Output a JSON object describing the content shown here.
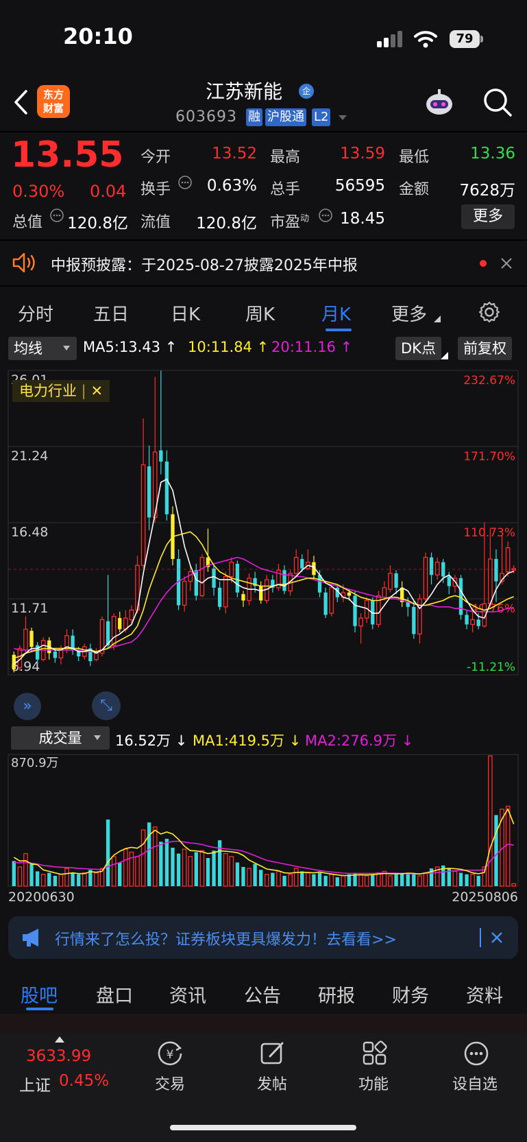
{
  "status_bar": {
    "time": "20:10",
    "battery": "79"
  },
  "nav": {
    "logo_line1": "东方",
    "logo_line2": "财富",
    "stock_name": "江苏新能",
    "qi_badge": "企",
    "stock_code": "603693",
    "tags": [
      "融",
      "沪股通",
      "L2"
    ]
  },
  "quote": {
    "price": "13.55",
    "change_pct": "0.30%",
    "change_abs": "0.04",
    "open_label": "今开",
    "open_value": "13.52",
    "high_label": "最高",
    "high_value": "13.59",
    "low_label": "最低",
    "low_value": "13.36",
    "turnover_label": "换手",
    "turnover_value": "0.63%",
    "volume_label": "总手",
    "volume_value": "56595",
    "amount_label": "金额",
    "amount_value": "7628万",
    "mcap_label": "总值",
    "mcap_value": "120.8亿",
    "float_label": "流值",
    "float_value": "120.8亿",
    "pe_label": "市盈",
    "pe_sup": "动",
    "pe_value": "18.45",
    "more_label": "更多"
  },
  "notice": {
    "text": "中报预披露：于2025-08-27披露2025年中报"
  },
  "period_tabs": [
    "分时",
    "五日",
    "日K",
    "周K",
    "月K",
    "更多"
  ],
  "active_period": "月K",
  "chart_controls": {
    "indicator_select": "均线",
    "ma5": "MA5:13.43",
    "ma10": "10:11.84",
    "ma20": "20:11.16",
    "dk_button": "DK点",
    "adjust_button": "前复权",
    "industry_tag": "电力行业",
    "volume_select": "成交量",
    "vol_value": "16.52万",
    "vol_ma1": "MA1:419.5万",
    "vol_ma2": "MA2:276.9万"
  },
  "colors": {
    "up": "#ff2d2d",
    "down": "#2ee04a",
    "accent": "#2e7cf6",
    "ma5": "#ffffff",
    "ma10": "#ffee2e",
    "ma20": "#e020d8",
    "candle_up": "#ff2d2d",
    "candle_down": "#3ad8dc"
  },
  "chart_data": {
    "type": "candlestick",
    "price_axis": [
      "26.01",
      "21.24",
      "16.48",
      "11.71",
      "6.94"
    ],
    "pct_axis": [
      "232.67%",
      "171.70%",
      "110.73%",
      "49.76%",
      "-11.21%"
    ],
    "y_range": [
      6.94,
      26.01
    ],
    "volume_axis_max": "870.9万",
    "x_start": "20200630",
    "x_end": "20250806",
    "candles": [
      [
        8.2,
        7.3,
        8.4,
        7.1
      ],
      [
        7.4,
        8.6,
        8.8,
        7.2
      ],
      [
        8.5,
        9.8,
        10.6,
        8.3
      ],
      [
        9.7,
        8.7,
        9.9,
        8.4
      ],
      [
        8.8,
        7.9,
        9.0,
        7.6
      ],
      [
        7.9,
        9.1,
        9.3,
        7.8
      ],
      [
        9.1,
        8.3,
        9.3,
        7.9
      ],
      [
        8.4,
        8.0,
        8.6,
        7.7
      ],
      [
        8.0,
        8.6,
        8.8,
        7.6
      ],
      [
        8.6,
        9.4,
        9.8,
        8.3
      ],
      [
        9.4,
        8.5,
        9.8,
        8.2
      ],
      [
        8.5,
        8.1,
        8.7,
        7.8
      ],
      [
        8.1,
        8.7,
        8.9,
        7.9
      ],
      [
        8.6,
        7.8,
        8.9,
        7.5
      ],
      [
        7.9,
        8.3,
        8.6,
        7.8
      ],
      [
        8.3,
        10.4,
        10.6,
        8.1
      ],
      [
        10.3,
        8.8,
        13.2,
        8.6
      ],
      [
        8.8,
        10.6,
        10.8,
        8.5
      ],
      [
        10.5,
        9.8,
        10.9,
        9.6
      ],
      [
        9.8,
        10.5,
        11.0,
        9.6
      ],
      [
        10.4,
        11.0,
        11.3,
        10.2
      ],
      [
        11.0,
        13.8,
        14.4,
        10.8
      ],
      [
        13.8,
        20.1,
        23.0,
        13.6
      ],
      [
        20.0,
        16.8,
        21.3,
        16.0
      ],
      [
        16.8,
        20.9,
        25.6,
        16.5
      ],
      [
        21.0,
        20.3,
        26.0,
        19.5
      ],
      [
        20.3,
        17.0,
        21.0,
        16.6
      ],
      [
        17.0,
        14.2,
        17.5,
        13.8
      ],
      [
        14.2,
        11.3,
        14.8,
        11.0
      ],
      [
        11.3,
        12.8,
        13.1,
        10.9
      ],
      [
        12.8,
        13.4,
        13.8,
        12.2
      ],
      [
        13.5,
        11.9,
        13.9,
        11.6
      ],
      [
        11.9,
        14.3,
        14.5,
        11.8
      ],
      [
        14.3,
        13.7,
        16.1,
        13.4
      ],
      [
        13.6,
        12.4,
        13.9,
        11.9
      ],
      [
        12.4,
        11.2,
        12.8,
        11.0
      ],
      [
        11.2,
        13.1,
        13.4,
        10.8
      ],
      [
        13.1,
        14.0,
        14.3,
        12.7
      ],
      [
        13.9,
        12.1,
        14.1,
        11.8
      ],
      [
        12.0,
        11.6,
        12.2,
        11.2
      ],
      [
        11.6,
        13.0,
        13.3,
        11.3
      ],
      [
        13.0,
        12.5,
        13.4,
        12.1
      ],
      [
        12.5,
        11.6,
        12.8,
        11.4
      ],
      [
        11.6,
        12.9,
        13.2,
        11.4
      ],
      [
        12.9,
        12.4,
        13.2,
        12.1
      ],
      [
        12.4,
        13.5,
        13.9,
        12.2
      ],
      [
        13.5,
        12.2,
        13.8,
        12.0
      ],
      [
        12.2,
        13.3,
        13.5,
        11.9
      ],
      [
        13.3,
        14.3,
        14.8,
        13.1
      ],
      [
        14.2,
        13.6,
        14.5,
        13.4
      ],
      [
        13.6,
        14.0,
        14.8,
        13.5
      ],
      [
        14.0,
        13.2,
        14.4,
        12.9
      ],
      [
        13.2,
        12.1,
        13.5,
        11.8
      ],
      [
        12.1,
        10.7,
        12.4,
        10.5
      ],
      [
        10.8,
        12.4,
        12.6,
        10.6
      ],
      [
        12.4,
        11.8,
        12.6,
        11.5
      ],
      [
        11.8,
        12.1,
        12.6,
        11.5
      ],
      [
        12.1,
        11.9,
        12.3,
        11.6
      ],
      [
        11.9,
        10.0,
        12.2,
        9.6
      ],
      [
        10.0,
        10.5,
        10.8,
        8.9
      ],
      [
        10.5,
        11.6,
        11.8,
        10.2
      ],
      [
        11.6,
        10.1,
        11.8,
        9.8
      ],
      [
        10.1,
        11.9,
        12.2,
        9.9
      ],
      [
        11.8,
        12.4,
        12.8,
        11.6
      ],
      [
        12.3,
        13.3,
        13.8,
        12.1
      ],
      [
        13.3,
        12.4,
        13.5,
        12.0
      ],
      [
        12.4,
        11.5,
        12.8,
        11.2
      ],
      [
        11.5,
        11.2,
        11.8,
        10.6
      ],
      [
        11.2,
        9.5,
        11.6,
        9.2
      ],
      [
        9.5,
        11.7,
        12.0,
        8.9
      ],
      [
        11.7,
        14.3,
        14.6,
        11.5
      ],
      [
        14.3,
        13.2,
        14.6,
        12.6
      ],
      [
        13.2,
        14.0,
        14.3,
        12.9
      ],
      [
        14.0,
        13.1,
        14.2,
        12.7
      ],
      [
        13.1,
        12.5,
        13.4,
        12.0
      ],
      [
        12.5,
        13.0,
        13.2,
        12.1
      ],
      [
        13.0,
        10.7,
        13.2,
        10.4
      ],
      [
        10.7,
        10.1,
        11.0,
        9.8
      ],
      [
        10.1,
        10.4,
        10.9,
        9.6
      ],
      [
        10.4,
        10.0,
        10.8,
        9.8
      ],
      [
        10.0,
        11.4,
        16.5,
        9.9
      ],
      [
        11.4,
        14.2,
        16.1,
        11.2
      ],
      [
        14.2,
        12.8,
        14.8,
        11.5
      ],
      [
        12.8,
        13.3,
        15.7,
        12.6
      ],
      [
        13.4,
        14.9,
        15.3,
        13.1
      ],
      [
        13.5,
        13.6,
        13.8,
        13.3
      ]
    ],
    "ma5": [
      7.6,
      7.9,
      8.3,
      8.6,
      8.6,
      8.8,
      8.7,
      8.5,
      8.5,
      8.7,
      8.6,
      8.4,
      8.4,
      8.5,
      8.3,
      8.5,
      8.9,
      9.3,
      9.5,
      9.8,
      10.1,
      11.0,
      13.3,
      15.2,
      17.0,
      19.0,
      19.2,
      18.5,
      16.8,
      15.0,
      13.8,
      12.9,
      12.7,
      13.0,
      13.1,
      12.9,
      12.9,
      12.9,
      12.6,
      12.4,
      12.3,
      12.3,
      12.2,
      12.3,
      12.5,
      12.6,
      12.5,
      12.8,
      13.1,
      13.5,
      13.8,
      13.7,
      13.2,
      12.7,
      12.5,
      12.2,
      11.8,
      11.7,
      11.3,
      11.2,
      11.1,
      10.8,
      10.8,
      11.3,
      11.8,
      12.1,
      12.4,
      12.2,
      11.6,
      11.1,
      11.5,
      12.0,
      12.6,
      13.0,
      13.2,
      12.8,
      12.2,
      11.6,
      11.0,
      10.6,
      10.5,
      11.4,
      12.3,
      12.9,
      13.3,
      13.43
    ],
    "ma10": [
      8.0,
      8.1,
      8.3,
      8.4,
      8.5,
      8.6,
      8.6,
      8.6,
      8.6,
      8.6,
      8.6,
      8.6,
      8.5,
      8.5,
      8.4,
      8.5,
      8.6,
      8.9,
      9.1,
      9.3,
      9.5,
      10.0,
      11.0,
      12.3,
      13.3,
      14.3,
      15.1,
      15.6,
      15.7,
      15.8,
      15.9,
      15.6,
      15.1,
      14.4,
      13.8,
      13.4,
      13.2,
      13.0,
      12.9,
      12.8,
      12.7,
      12.6,
      12.5,
      12.5,
      12.5,
      12.6,
      12.6,
      12.7,
      12.8,
      12.9,
      13.0,
      13.0,
      12.9,
      12.8,
      12.7,
      12.6,
      12.4,
      12.2,
      12.0,
      11.8,
      11.7,
      11.6,
      11.6,
      11.7,
      11.8,
      11.8,
      11.7,
      11.6,
      11.4,
      11.3,
      11.3,
      11.4,
      11.5,
      11.6,
      11.8,
      11.9,
      11.8,
      11.5,
      11.3,
      11.1,
      11.0,
      11.1,
      11.3,
      11.5,
      11.7,
      11.84
    ],
    "ma20": [
      8.6,
      8.5,
      8.5,
      8.5,
      8.5,
      8.5,
      8.5,
      8.5,
      8.5,
      8.5,
      8.5,
      8.5,
      8.4,
      8.4,
      8.4,
      8.5,
      8.6,
      8.7,
      8.8,
      8.9,
      9.0,
      9.3,
      9.8,
      10.4,
      11.0,
      11.6,
      12.1,
      12.5,
      12.8,
      13.0,
      13.2,
      13.4,
      13.6,
      13.8,
      13.9,
      14.0,
      14.1,
      14.2,
      14.3,
      14.2,
      14.0,
      13.8,
      13.6,
      13.5,
      13.4,
      13.3,
      13.2,
      13.2,
      13.1,
      13.1,
      13.0,
      12.9,
      12.8,
      12.7,
      12.6,
      12.5,
      12.4,
      12.3,
      12.2,
      12.1,
      12.0,
      11.9,
      11.8,
      11.8,
      11.7,
      11.7,
      11.6,
      11.5,
      11.4,
      11.3,
      11.3,
      11.3,
      11.2,
      11.2,
      11.2,
      11.1,
      11.1,
      11.0,
      10.9,
      10.9,
      10.9,
      10.9,
      10.9,
      11.0,
      11.1,
      11.16
    ],
    "volumes": [
      170,
      130,
      220,
      150,
      100,
      80,
      90,
      70,
      80,
      120,
      90,
      80,
      90,
      110,
      90,
      120,
      450,
      200,
      160,
      250,
      230,
      200,
      380,
      430,
      400,
      300,
      320,
      260,
      220,
      250,
      200,
      230,
      240,
      190,
      240,
      310,
      220,
      200,
      160,
      130,
      120,
      150,
      110,
      80,
      90,
      100,
      70,
      80,
      120,
      100,
      90,
      80,
      90,
      70,
      80,
      60,
      70,
      80,
      90,
      80,
      70,
      80,
      90,
      100,
      70,
      80,
      90,
      90,
      80,
      70,
      90,
      120,
      130,
      140,
      120,
      100,
      90,
      80,
      80,
      70,
      130,
      880,
      480,
      520,
      540,
      16.52
    ],
    "vol_ma1": [
      195,
      170,
      172,
      150,
      145,
      110,
      100,
      90,
      80,
      85,
      90,
      85,
      85,
      98,
      94,
      100,
      165,
      210,
      236,
      254,
      262,
      256,
      284,
      344,
      378,
      352,
      366,
      352,
      316,
      270,
      240,
      238,
      232,
      220,
      226,
      238,
      236,
      232,
      226,
      208,
      176,
      156,
      136,
      116,
      110,
      104,
      90,
      88,
      92,
      94,
      92,
      90,
      96,
      88,
      82,
      76,
      72,
      72,
      76,
      76,
      76,
      78,
      82,
      86,
      84,
      84,
      84,
      88,
      86,
      82,
      90,
      98,
      110,
      118,
      120,
      118,
      114,
      104,
      90,
      84,
      92,
      260,
      364,
      454,
      520,
      419.5
    ],
    "vol_ma2": [
      160,
      158,
      160,
      156,
      150,
      140,
      136,
      130,
      128,
      126,
      124,
      120,
      118,
      116,
      114,
      112,
      132,
      148,
      160,
      178,
      192,
      200,
      220,
      248,
      268,
      280,
      294,
      302,
      304,
      298,
      292,
      288,
      282,
      270,
      262,
      256,
      252,
      248,
      244,
      236,
      222,
      206,
      190,
      174,
      166,
      158,
      150,
      142,
      134,
      126,
      120,
      112,
      106,
      100,
      96,
      92,
      88,
      86,
      86,
      86,
      86,
      86,
      88,
      88,
      88,
      88,
      86,
      84,
      84,
      84,
      86,
      88,
      92,
      96,
      100,
      104,
      106,
      108,
      108,
      108,
      110,
      170,
      212,
      254,
      284,
      276.9
    ]
  },
  "banner": {
    "text": "行情来了怎么投？证券板块更具爆发力！去看看>>"
  },
  "bottom_tabs": [
    "股吧",
    "盘口",
    "资讯",
    "公告",
    "研报",
    "财务",
    "资料"
  ],
  "index_ticker": {
    "value": "3633.99",
    "name": "上证",
    "change": "0.45%"
  },
  "bottom_nav": [
    "交易",
    "发帖",
    "功能",
    "设自选"
  ]
}
